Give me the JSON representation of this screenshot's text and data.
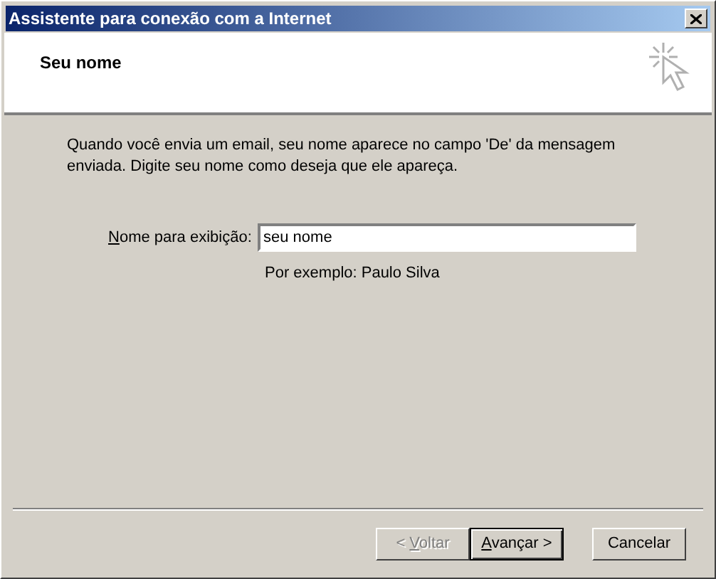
{
  "window": {
    "title": "Assistente para conexão com a Internet"
  },
  "header": {
    "title": "Seu nome"
  },
  "description": "Quando você envia um email, seu nome aparece no campo 'De' da mensagem enviada. Digite seu nome como deseja que ele apareça.",
  "field": {
    "label": "Nome para exibição:",
    "mnemonic": true,
    "value": "seu nome",
    "hint": "Por exemplo: Paulo Silva"
  },
  "buttons": [
    {
      "kind": "back",
      "label": "< Voltar",
      "mnemonic": true,
      "disabled": true,
      "default": false
    },
    {
      "kind": "next",
      "label": "Avançar >",
      "mnemonic": true,
      "disabled": false,
      "default": true
    },
    {
      "kind": "cancel",
      "label": "Cancelar",
      "mnemonic": false,
      "disabled": false,
      "default": false
    }
  ]
}
